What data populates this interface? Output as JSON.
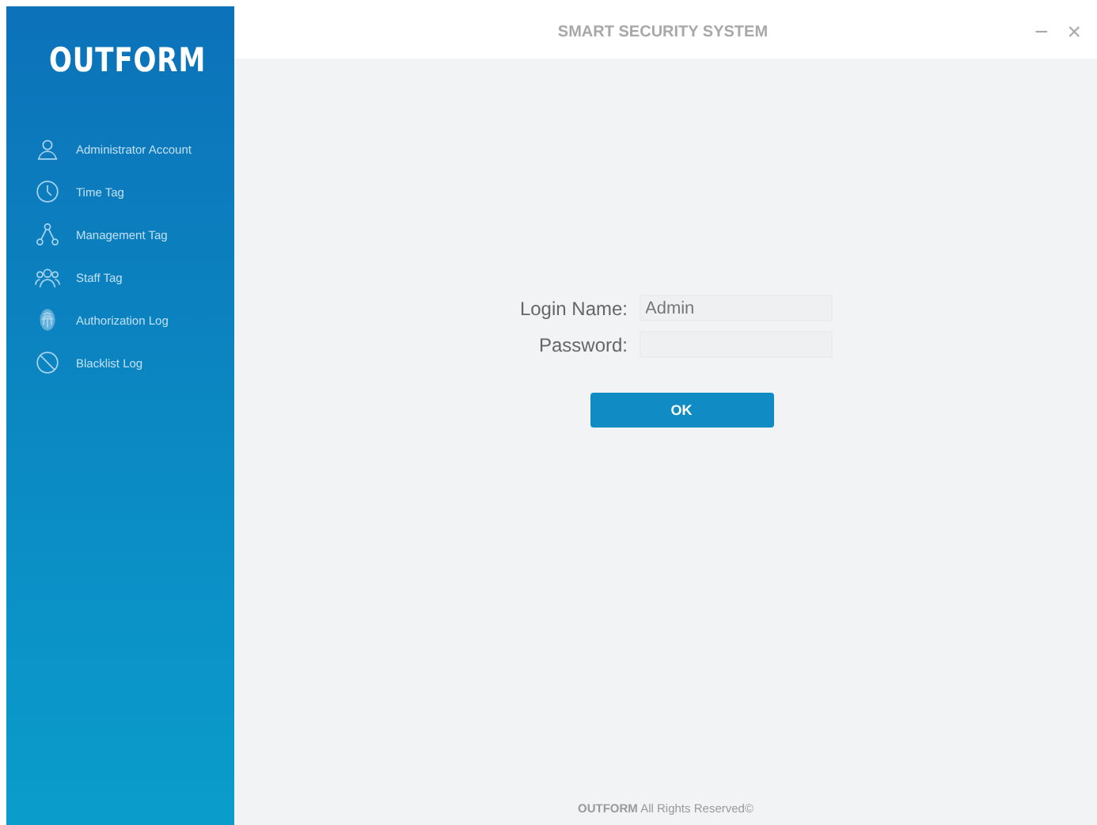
{
  "logo": "OUTFORM",
  "window": {
    "title": "SMART SECURITY SYSTEM",
    "minimize": "−",
    "close": "×"
  },
  "sidebar": {
    "items": [
      {
        "label": "Administrator Account"
      },
      {
        "label": "Time Tag"
      },
      {
        "label": "Management Tag"
      },
      {
        "label": "Staff Tag"
      },
      {
        "label": "Authorization Log"
      },
      {
        "label": "Blacklist Log"
      }
    ]
  },
  "login": {
    "name_label": "Login Name:",
    "name_value": "Admin",
    "password_label": "Password:",
    "button": "OK"
  },
  "footer": "**OUTFORM** All Rights Reserved©"
}
